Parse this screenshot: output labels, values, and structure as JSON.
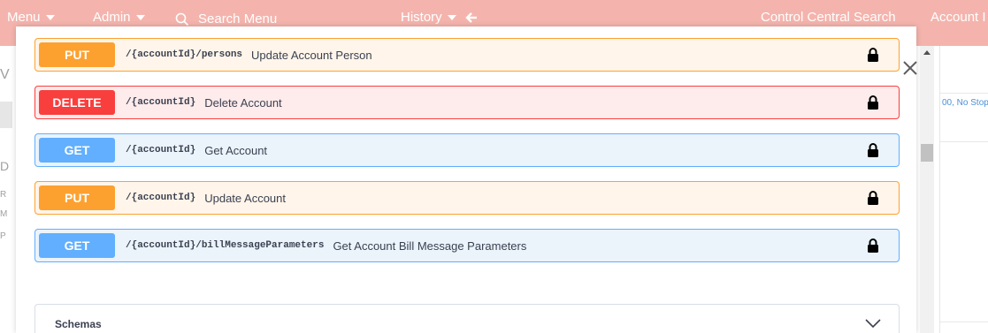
{
  "nav": {
    "menu_label": "Menu",
    "admin_label": "Admin",
    "search_placeholder": "Search Menu",
    "history_label": "History",
    "control_central_label": "Control Central Search",
    "account_label": "Account I"
  },
  "operations": [
    {
      "method": "PUT",
      "path": "/{accountId}/persons",
      "summary": "Update Account Person"
    },
    {
      "method": "DELETE",
      "path": "/{accountId}",
      "summary": "Delete Account"
    },
    {
      "method": "GET",
      "path": "/{accountId}",
      "summary": "Get Account"
    },
    {
      "method": "PUT",
      "path": "/{accountId}",
      "summary": "Update Account"
    },
    {
      "method": "GET",
      "path": "/{accountId}/billMessageParameters",
      "summary": "Get Account Bill Message Parameters"
    }
  ],
  "schemas": {
    "label": "Schemas"
  },
  "background": {
    "right_text": "00, No Stop",
    "left_glyphs": [
      "V",
      "D",
      "R",
      "M",
      "P"
    ]
  },
  "colors": {
    "topbar": "#f4b4ad",
    "put": "#fca130",
    "delete": "#f93e3e",
    "get": "#61affe"
  }
}
